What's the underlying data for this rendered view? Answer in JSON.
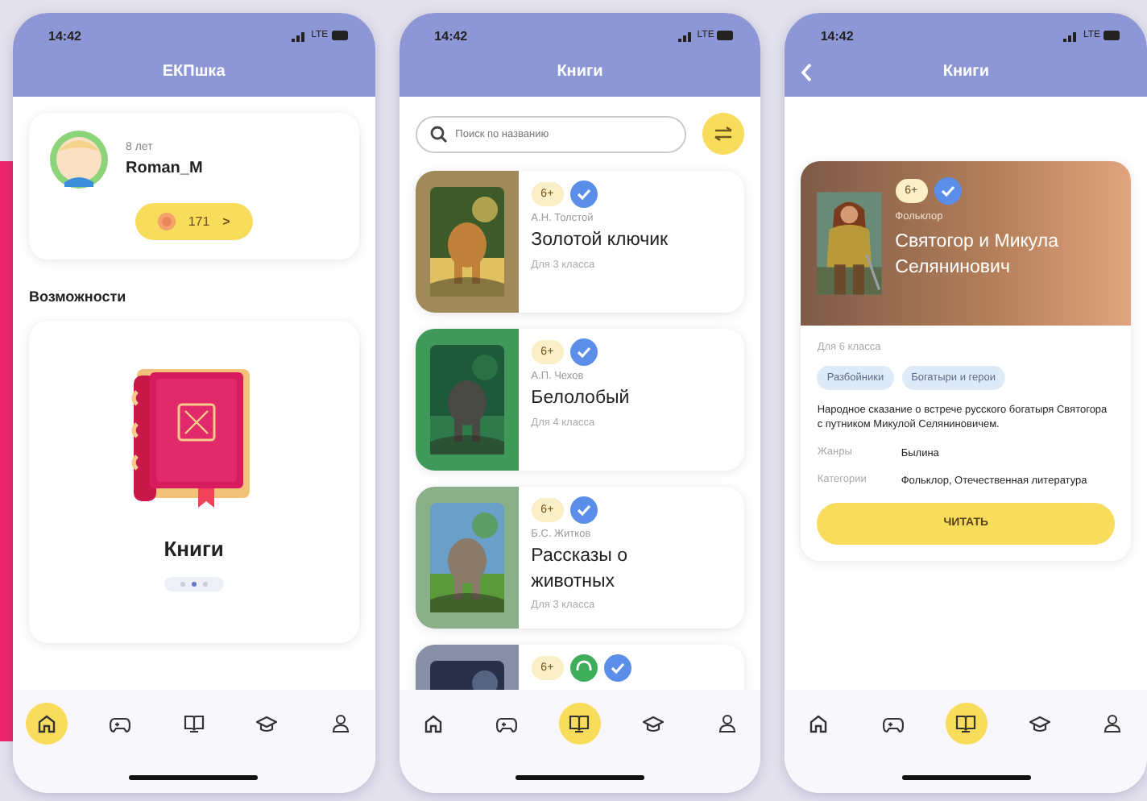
{
  "screens": [
    {
      "kind": "home",
      "status": {
        "time": "14:42",
        "network": "LTE"
      },
      "title": "ЕКПшка",
      "profile": {
        "age": "8 лет",
        "name": "Roman_M",
        "points": "171",
        "arrow": ">"
      },
      "section_title": "Возможности",
      "feature": {
        "label": "Книги",
        "pages": [
          {
            "selected": false
          },
          {
            "selected": true
          },
          {
            "selected": false
          }
        ]
      },
      "tabs": [
        {
          "kind": "home",
          "selected": true
        },
        {
          "kind": "games",
          "selected": false
        },
        {
          "kind": "books",
          "selected": false
        },
        {
          "kind": "study",
          "selected": false
        },
        {
          "kind": "profile",
          "selected": false
        }
      ]
    },
    {
      "kind": "list",
      "status": {
        "time": "14:42",
        "network": "LTE"
      },
      "title": "Книги",
      "search": {
        "placeholder": "Поиск по названию"
      },
      "books": [
        {
          "age": "6+",
          "verified": true,
          "author": "А.Н. Толстой",
          "title": "Золотой ключик",
          "grade": "Для 3 класса"
        },
        {
          "age": "6+",
          "verified": true,
          "author": "А.П. Чехов",
          "title": "Белолобый",
          "grade": "Для 4 класса"
        },
        {
          "age": "6+",
          "verified": true,
          "author": "Б.С. Житков",
          "title": "Рассказы о животных",
          "grade": "Для 3 класса"
        },
        {
          "age": "6+",
          "audio": true,
          "verified": true
        }
      ],
      "tabs": [
        {
          "kind": "home",
          "selected": false
        },
        {
          "kind": "games",
          "selected": false
        },
        {
          "kind": "books",
          "selected": true
        },
        {
          "kind": "study",
          "selected": false
        },
        {
          "kind": "profile",
          "selected": false
        }
      ]
    },
    {
      "kind": "detail",
      "status": {
        "time": "14:42",
        "network": "LTE"
      },
      "title": "Книги",
      "back": true,
      "book": {
        "age": "6+",
        "verified": true,
        "category_label": "Фольклор",
        "title": "Святогор и Микула Селянинович",
        "grade": "Для 6 класса",
        "tags": [
          "Разбойники",
          "Богатыри и герои"
        ],
        "description": "Народное сказание о встрече русского богатыря Святогора с путником Микулой Селяниновичем.",
        "facts": [
          {
            "label": "Жанры",
            "value": "Былина"
          },
          {
            "label": "Категории",
            "value": "Фольклор, Отечественная литература"
          }
        ],
        "action": "ЧИТАТЬ"
      },
      "tabs": [
        {
          "kind": "home",
          "selected": false
        },
        {
          "kind": "games",
          "selected": false
        },
        {
          "kind": "books",
          "selected": true
        },
        {
          "kind": "study",
          "selected": false
        },
        {
          "kind": "profile",
          "selected": false
        }
      ]
    }
  ]
}
